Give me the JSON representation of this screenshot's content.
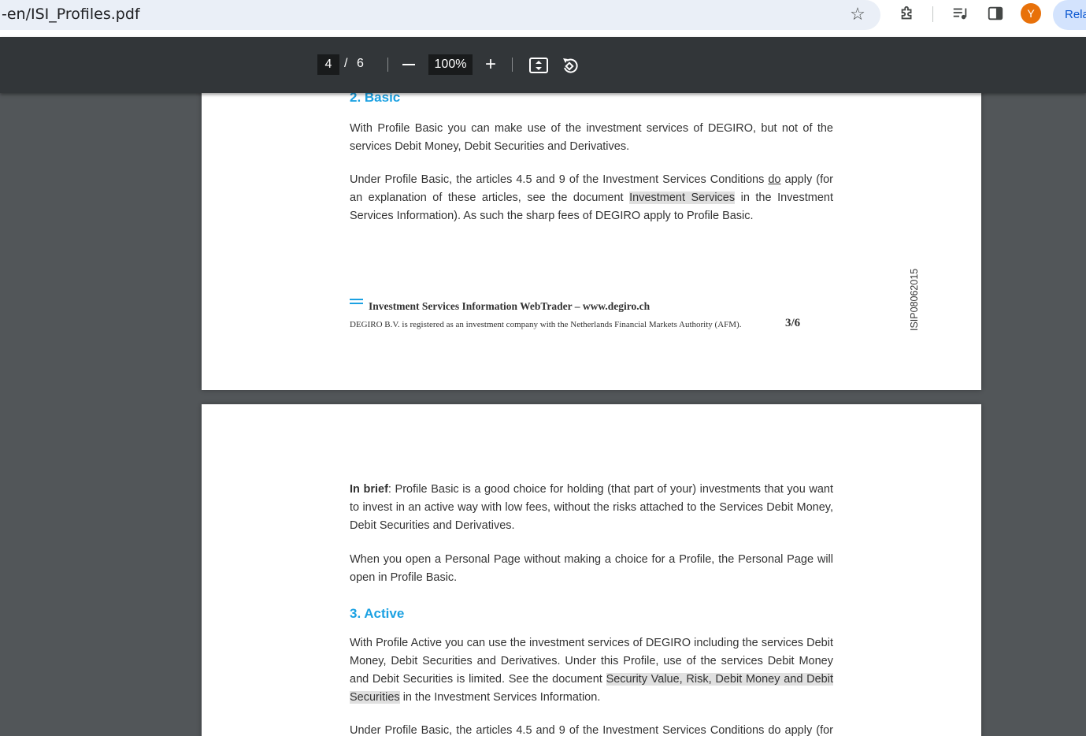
{
  "browser": {
    "url": "-en/ISI_Profiles.pdf",
    "avatar_letter": "Y",
    "relaunch_label": "Rela",
    "accent_color": "#0b57d0",
    "avatar_color": "#e8710a"
  },
  "pdf_toolbar": {
    "current_page": "4",
    "page_separator": "/",
    "total_pages": "6",
    "zoom": "100%"
  },
  "page3": {
    "heading": "2.  Basic",
    "paragraph1": "With Profile Basic you can make use of the investment services of DEGIRO, but not of the services Debit Money, Debit Securities and Derivatives.",
    "paragraph2": {
      "part1": "Under Profile Basic, the articles 4.5 and 9 of the Investment Services Conditions ",
      "underlined": "do",
      "part2": " apply (for an explanation of these articles, see the document ",
      "highlighted": "Investment Services",
      "part3": " in the Investment Services Information). As such the sharp fees of DEGIRO apply to Profile Basic."
    },
    "footer_title": "Investment Services Information WebTrader – www.degiro.ch",
    "footer_legal": "DEGIRO B.V. is registered as an investment company with the Netherlands Financial Markets Authority (AFM).",
    "footer_page_number": "3/6",
    "document_code": "ISIP08062015"
  },
  "page4": {
    "brief_label": "In brief",
    "brief_text": ": Profile Basic is a good choice for holding (that part of your) investments that you want to invest in an active way with low fees, without the risks attached to the Services Debit Money, Debit Securities and Derivatives.",
    "paragraph_personal": "When you open a Personal Page without making a choice for a Profile, the Personal Page will open in Profile Basic.",
    "heading": "3.  Active",
    "paragraph_active": {
      "part1": "With Profile Active you can use the investment services of DEGIRO including the services Debit Money, Debit Securities and Derivatives. Under this Profile, use of the services Debit Money and Debit Securities is limited. See the document ",
      "highlighted": "Security Value, Risk, Debit Money and Debit Securities",
      "part2": " in the Investment Services Information."
    },
    "paragraph_cut": "Under Profile Basic, the articles 4.5 and 9 of the Investment Services Conditions do apply (for an"
  },
  "colors": {
    "heading_blue": "#1ba1e2",
    "viewer_background": "#525659",
    "toolbar_background": "#323639"
  }
}
